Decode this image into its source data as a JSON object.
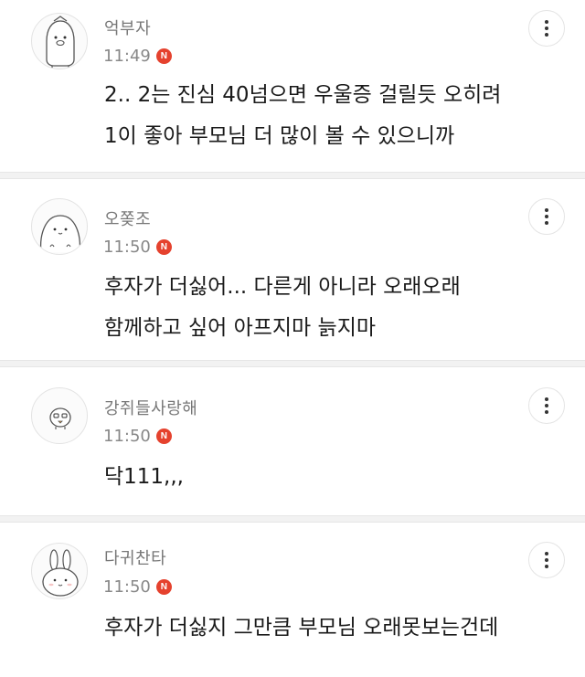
{
  "comments": [
    {
      "author": "억부자",
      "time": "11:49",
      "badge": "N",
      "body": "2.. 2는 진심 40넘으면 우울증 걸릴듯 오히려\n1이 좋아 부모님 더 많이 볼 수 있으니까",
      "avatar_icon": "penguin-character-icon"
    },
    {
      "author": "오쫒조",
      "time": "11:50",
      "badge": "N",
      "body": "후자가 더싫어... 다른게 아니라 오래오래\n함께하고 싶어 아프지마 늙지마",
      "avatar_icon": "round-blob-character-icon"
    },
    {
      "author": "강쥐들사랑해",
      "time": "11:50",
      "badge": "N",
      "body": "닥111,,,",
      "avatar_icon": "small-chick-character-icon"
    },
    {
      "author": "다귀찬타",
      "time": "11:50",
      "badge": "N",
      "body": "후자가 더싫지 그만큼 부모님 오래못보는건데",
      "avatar_icon": "bunny-character-icon"
    }
  ],
  "icons": {
    "more": "more-vertical-icon",
    "badge": "new-badge-icon"
  },
  "colors": {
    "badge": "#e5422e",
    "author": "#777777",
    "time": "#888888",
    "divider": "#f2f2f2"
  }
}
